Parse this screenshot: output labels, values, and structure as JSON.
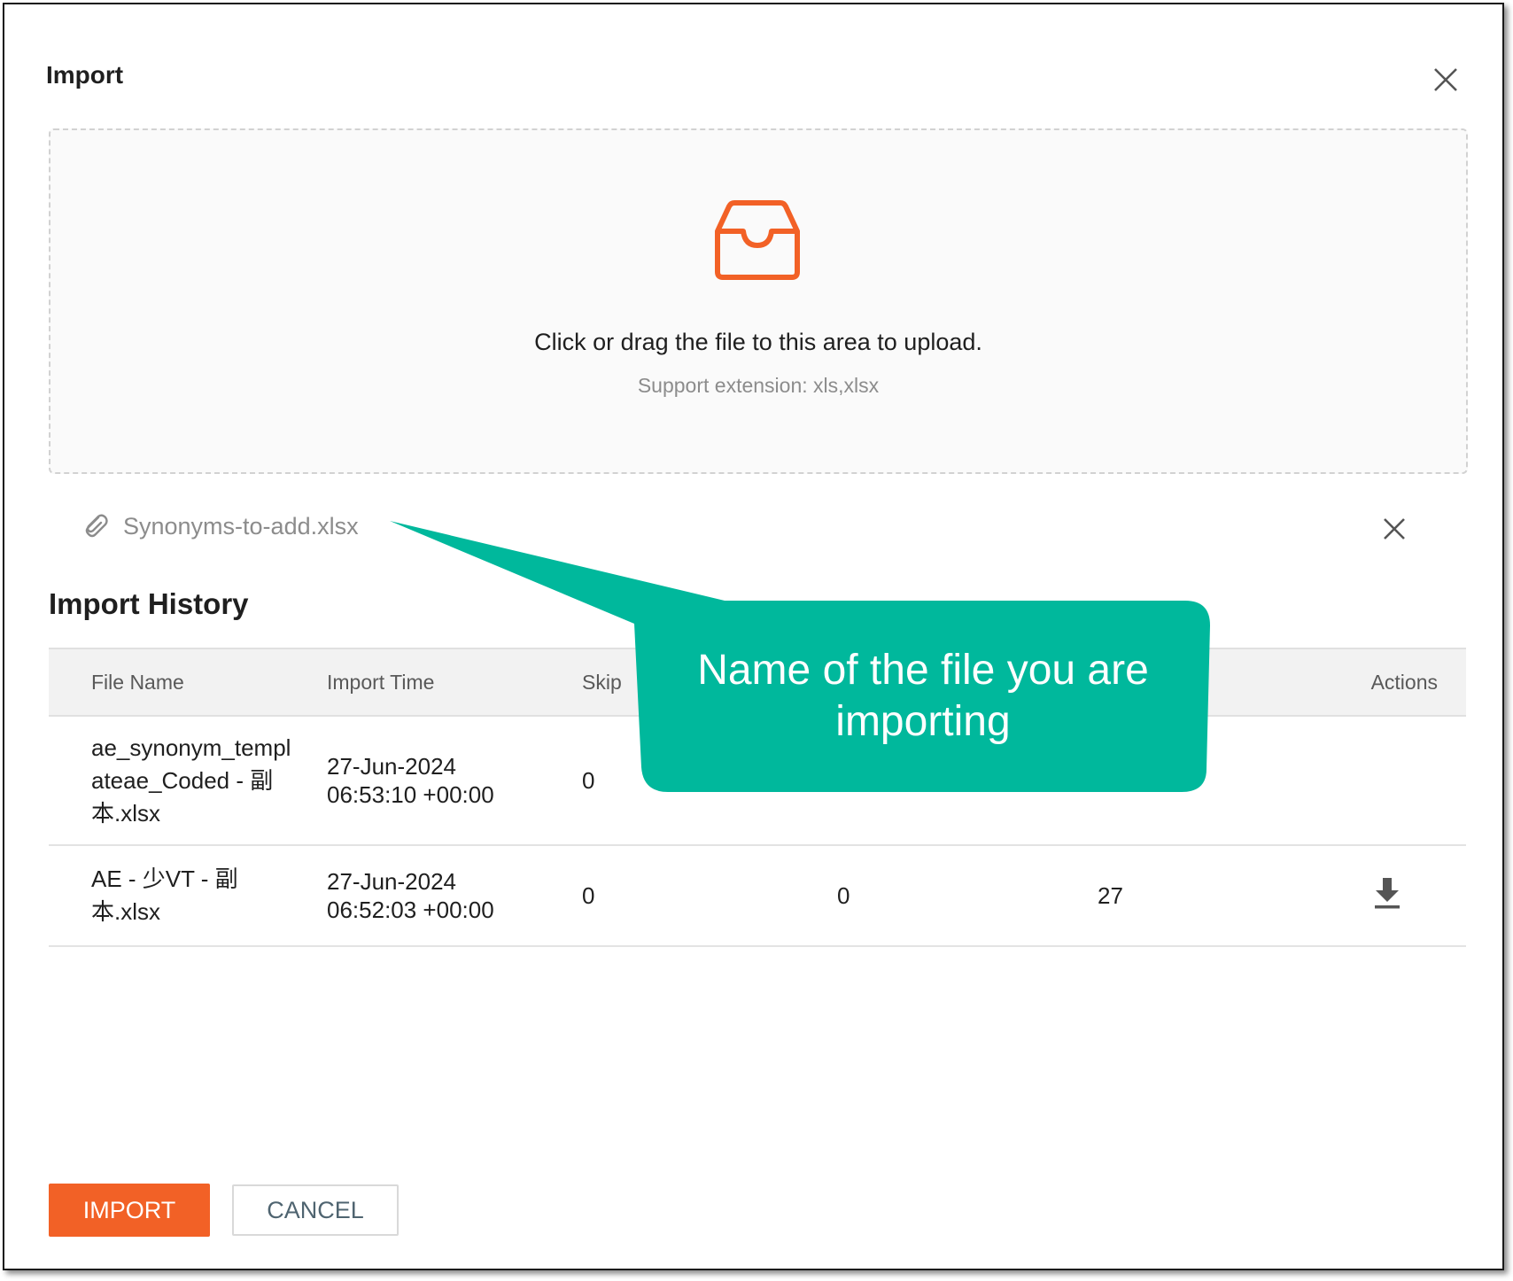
{
  "dialog": {
    "title": "Import"
  },
  "upload": {
    "text": "Click or drag the file to this area to upload.",
    "hint": "Support extension: xls,xlsx",
    "icon": "inbox-icon",
    "accent_color": "#f26126"
  },
  "selected_file": {
    "name": "Synonyms-to-add.xlsx"
  },
  "history": {
    "title": "Import History",
    "columns": [
      "File Name",
      "Import Time",
      "Skip",
      "",
      "",
      "Actions"
    ],
    "rows": [
      {
        "file_name": "ae_synonym_templ ateae_Coded - 副本.xlsx",
        "time_date": "27-Jun-2024",
        "time_clock": "06:53:10 +00:00",
        "skip": "0",
        "col4": "",
        "col5": ""
      },
      {
        "file_name": "AE - 少VT - 副本.xlsx",
        "time_date": "27-Jun-2024",
        "time_clock": "06:52:03 +00:00",
        "skip": "0",
        "col4": "0",
        "col5": "27"
      }
    ]
  },
  "callout": {
    "text": "Name of the file you are importing",
    "color": "#00b89c"
  },
  "footer": {
    "import_label": "IMPORT",
    "cancel_label": "CANCEL"
  }
}
